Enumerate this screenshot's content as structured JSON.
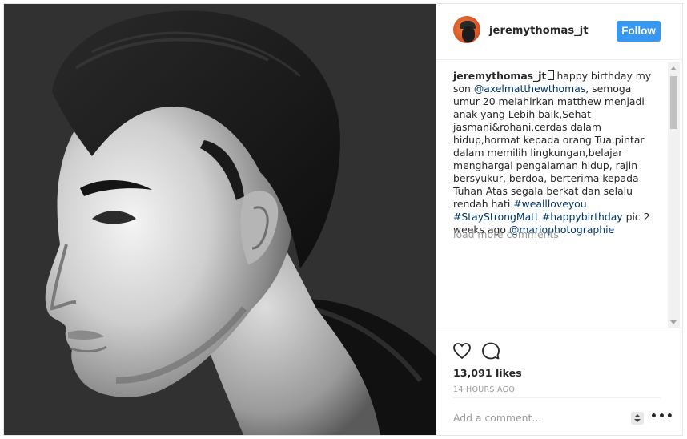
{
  "header": {
    "username": "jeremythomas_jt",
    "follow_label": "Follow"
  },
  "caption": {
    "username": "jeremythomas_jt",
    "text_1": "happy birthday my son",
    "mention_1": "@axelmatthewthomas",
    "text_2": ", semoga umur 20 melahirkan matthew menjadi anak yang Lebih baik,Sehat jasmani&rohani,cerdas dalam hidup,hormat kepada orang Tua,pintar dalam memilih lingkungan,belajar menghargai pengalaman hidup, rajin bersyukur, berdoa, berterima kepada Tuhan Atas segala berkat dan selalu rendah hati",
    "hashtag_1": "#weallloveyou",
    "hashtag_2": "#StayStrongMatt",
    "hashtag_3": "#happybirthday",
    "text_3": "pic 2 weeks ago",
    "mention_2": "@mariophotographie"
  },
  "load_more_label": "load more comments",
  "likes_label": "13,091 likes",
  "time_label": "14 HOURS AGO",
  "comment_input": {
    "placeholder": "Add a comment..."
  },
  "more_label": "•••",
  "icons": {
    "like": "heart-icon",
    "comment": "comment-bubble-icon",
    "more": "more-options-icon"
  },
  "colors": {
    "follow_button": "#3897f0",
    "link": "#003569",
    "muted": "#999999"
  }
}
